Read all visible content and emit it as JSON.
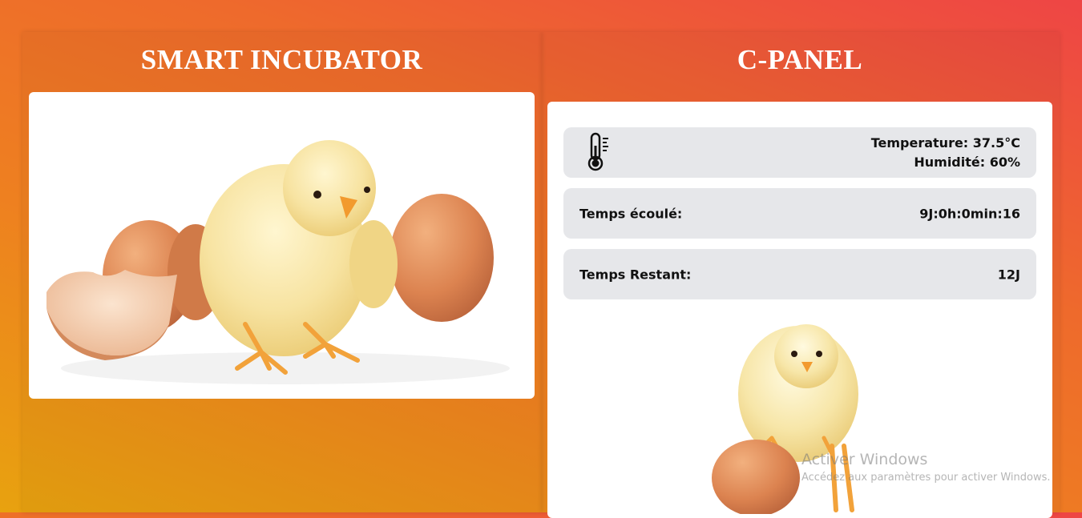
{
  "left_panel": {
    "title": "SMART INCUBATOR",
    "image_icon": "chick-with-eggshells-photo"
  },
  "right_panel": {
    "title": "C-PANEL",
    "sensor": {
      "icon": "thermometer-icon",
      "temperature": "Temperature: 37.5°C",
      "humidity": "Humidité: 60%"
    },
    "elapsed": {
      "label": "Temps écoulé:",
      "value": "9J:0h:0min:16"
    },
    "remaining": {
      "label": "Temps Restant:",
      "value": "12J"
    },
    "image_icon": "chick-on-egg-photo"
  },
  "os_watermark": {
    "title": "Activer Windows",
    "subtitle": "Accédez aux paramètres pour activer Windows."
  }
}
